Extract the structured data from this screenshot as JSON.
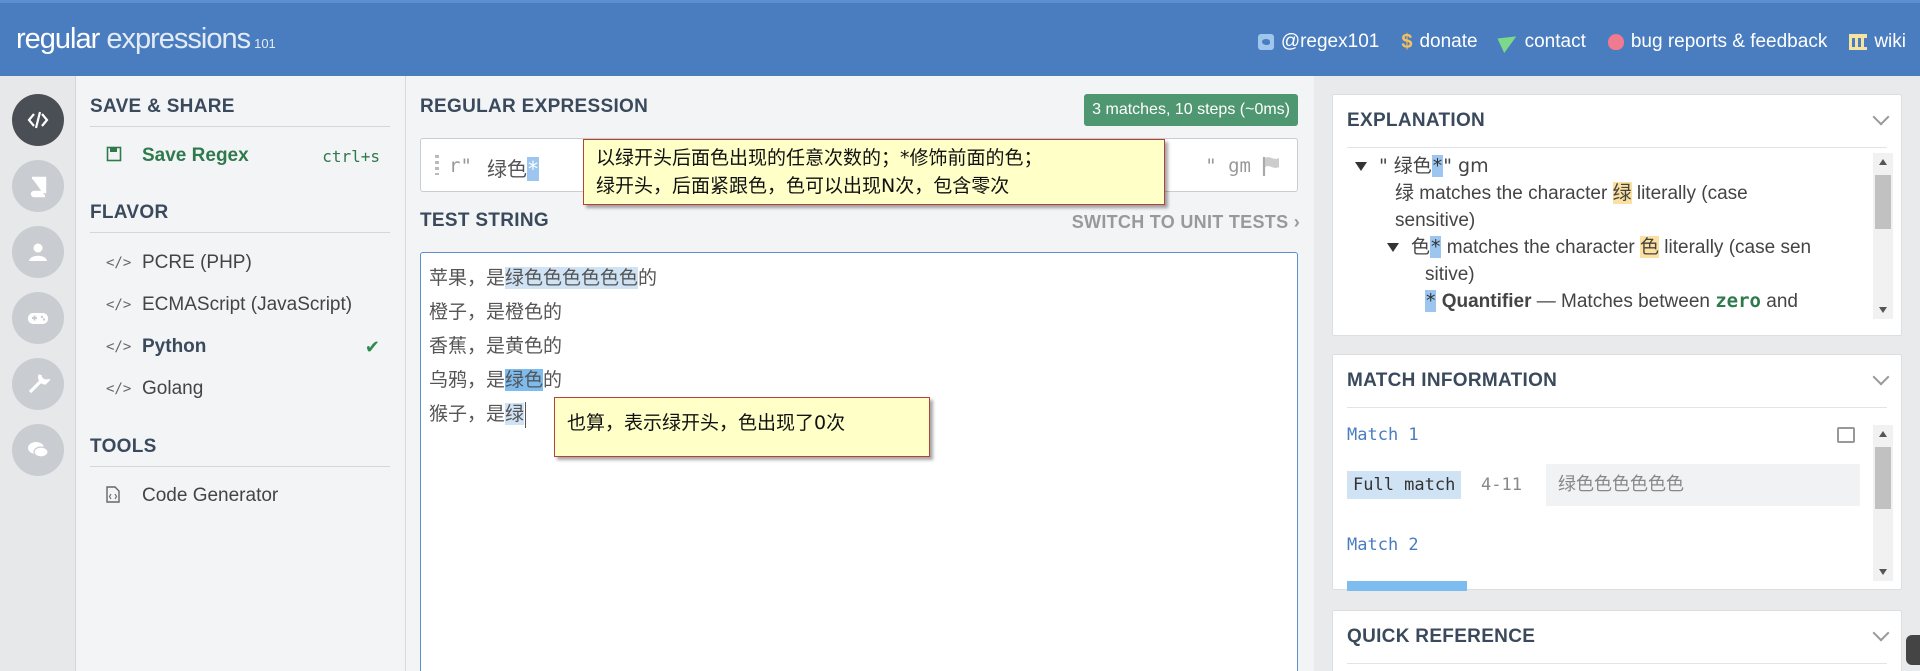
{
  "header": {
    "brand_1": "regular",
    "brand_2": " expressions",
    "brand_3": "101",
    "links": [
      {
        "label": "@regex101",
        "icon": "twitter-icon"
      },
      {
        "label": "donate",
        "icon": "dollar-icon"
      },
      {
        "label": "contact",
        "icon": "paper-plane-icon"
      },
      {
        "label": "bug reports & feedback",
        "icon": "bug-icon"
      },
      {
        "label": "wiki",
        "icon": "bank-icon"
      }
    ]
  },
  "sidebar": {
    "save_share_title": "SAVE & SHARE",
    "save_label": "Save Regex",
    "save_shortcut": "ctrl+s",
    "flavor_title": "FLAVOR",
    "flavors": [
      {
        "label": "PCRE (PHP)",
        "selected": false
      },
      {
        "label": "ECMAScript (JavaScript)",
        "selected": false
      },
      {
        "label": "Python",
        "selected": true
      },
      {
        "label": "Golang",
        "selected": false
      }
    ],
    "tools_title": "TOOLS",
    "code_generator": "Code Generator"
  },
  "regex": {
    "label": "REGULAR EXPRESSION",
    "badge": "3 matches, 10 steps (~0ms)",
    "delimiter_open": "r\"",
    "pattern_text": "绿色",
    "pattern_quant": "*",
    "delimiter_close": "\" gm"
  },
  "test": {
    "label": "TEST STRING",
    "switch_label": "SWITCH TO UNIT TESTS",
    "lines": [
      {
        "pre": "苹果，是",
        "light": "",
        "dark": "",
        "match": "绿色色色色色色",
        "post": "的"
      },
      {
        "pre": "橙子，是橙色的",
        "match": "",
        "post": ""
      },
      {
        "pre": "香蕉，是黄色的",
        "match": "",
        "post": ""
      },
      {
        "pre": "乌鸦，是",
        "match": "绿色",
        "post": "的"
      },
      {
        "pre": "猴子，是",
        "match": "绿",
        "post": ""
      }
    ]
  },
  "annotations": {
    "note1_line1": "以绿开头后面色出现的任意次数的；*修饰前面的色；",
    "note1_line2": "绿开头，后面紧跟色，色可以出现N次，包含零次",
    "note2": "也算，表示绿开头，色出现了0次"
  },
  "explanation": {
    "title": "EXPLANATION",
    "l1_open": "\" 绿色",
    "l1_q": "*",
    "l1_close": "\" gm",
    "l2_char": "绿",
    "l2_a": " matches the character ",
    "l2_b": " literally (case",
    "l3": "sensitive)",
    "l4_char": "色",
    "l4_a": " matches the character ",
    "l4_b": " literally (case sen",
    "l5": "sitive)",
    "l6_q": "*",
    "l6_bold": " Quantifier",
    "l6_a": " — Matches between ",
    "l6_mono": "zero",
    "l6_b": " and"
  },
  "match_info": {
    "title": "MATCH INFORMATION",
    "match1_label": "Match 1",
    "full_match": "Full match",
    "match1_range": "4-11",
    "match1_value": "绿色色色色色色",
    "match2_label": "Match 2"
  },
  "quick_reference": {
    "title": "QUICK REFERENCE"
  }
}
